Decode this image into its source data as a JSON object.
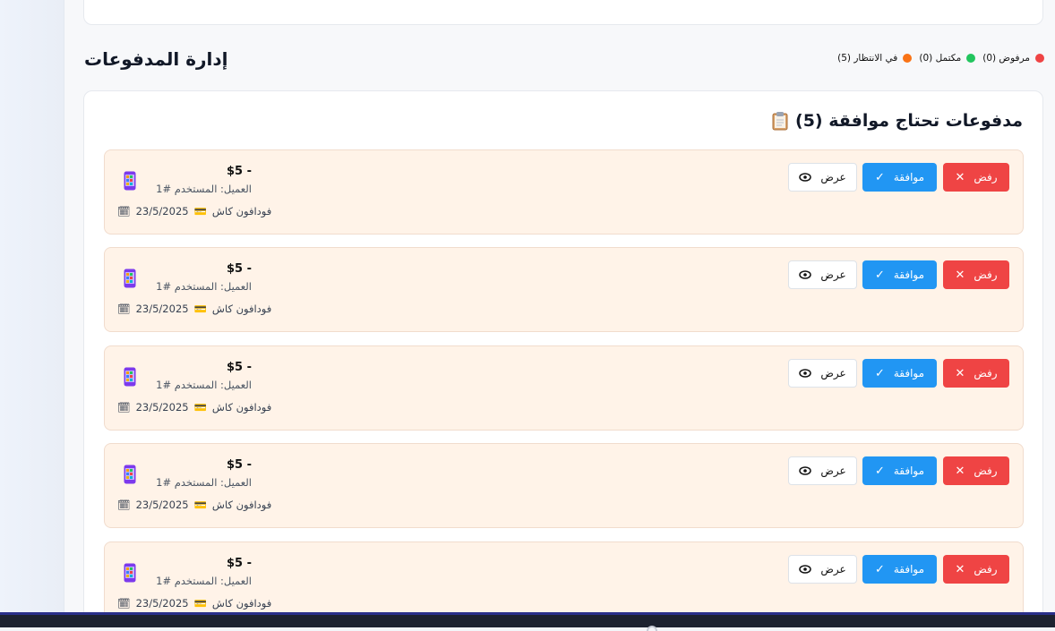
{
  "page": {
    "title": "إدارة المدفوعات"
  },
  "legend": {
    "rejected": "مرفوض (0)",
    "completed": "مكتمل (0)",
    "pending": "في الانتظار (5)"
  },
  "panel": {
    "title": "مدفوعات تحتاج موافقة (5)"
  },
  "buttons": {
    "reject": "رفض",
    "approve": "موافقة",
    "view": "عرض"
  },
  "payments": [
    {
      "amount": "$5 -",
      "customer": "العميل: المستخدم #1",
      "method": "فودافون كاش",
      "date": "23/5/2025"
    },
    {
      "amount": "$5 -",
      "customer": "العميل: المستخدم #1",
      "method": "فودافون كاش",
      "date": "23/5/2025"
    },
    {
      "amount": "$5 -",
      "customer": "العميل: المستخدم #1",
      "method": "فودافون كاش",
      "date": "23/5/2025"
    },
    {
      "amount": "$5 -",
      "customer": "العميل: المستخدم #1",
      "method": "فودافون كاش",
      "date": "23/5/2025"
    },
    {
      "amount": "$5 -",
      "customer": "العميل: المستخدم #1",
      "method": "فودافون كاش",
      "date": "23/5/2025"
    }
  ],
  "colors": {
    "reject": "#ef4444",
    "approve": "#2196f3",
    "pending_row": "#fff3e8",
    "status_rejected": "#ef4444",
    "status_completed": "#22c55e",
    "status_pending": "#f97316"
  }
}
